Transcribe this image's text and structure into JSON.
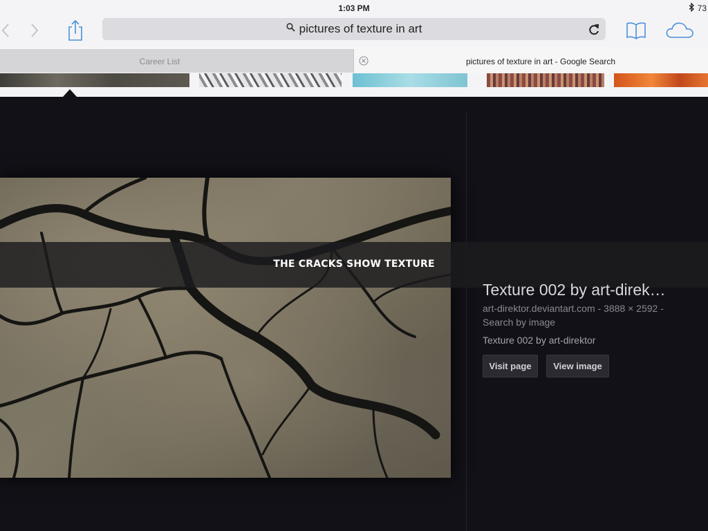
{
  "status_bar": {
    "time": "1:03 PM",
    "battery": "73"
  },
  "toolbar": {
    "address_text": "pictures of texture in art",
    "icons": [
      "back-icon",
      "forward-icon",
      "share-icon",
      "search-icon",
      "reload-icon",
      "bookmarks-icon",
      "cloud-icon"
    ]
  },
  "tabs": [
    {
      "label": "Career List",
      "active": false
    },
    {
      "label": "pictures of texture in art - Google Search",
      "active": true
    }
  ],
  "caption": "THE CRACKS SHOW TEXTURE",
  "result": {
    "title": "Texture 002 by art-direk…",
    "meta": "art-direktor.deviantart.com - 3888 × 2592 -",
    "search_by_image": "Search by image",
    "description": "Texture 002 by art-direktor",
    "visit_label": "Visit page",
    "view_label": "View image"
  },
  "colors": {
    "ios_blue": "#4a90d9",
    "background": "#121117"
  }
}
